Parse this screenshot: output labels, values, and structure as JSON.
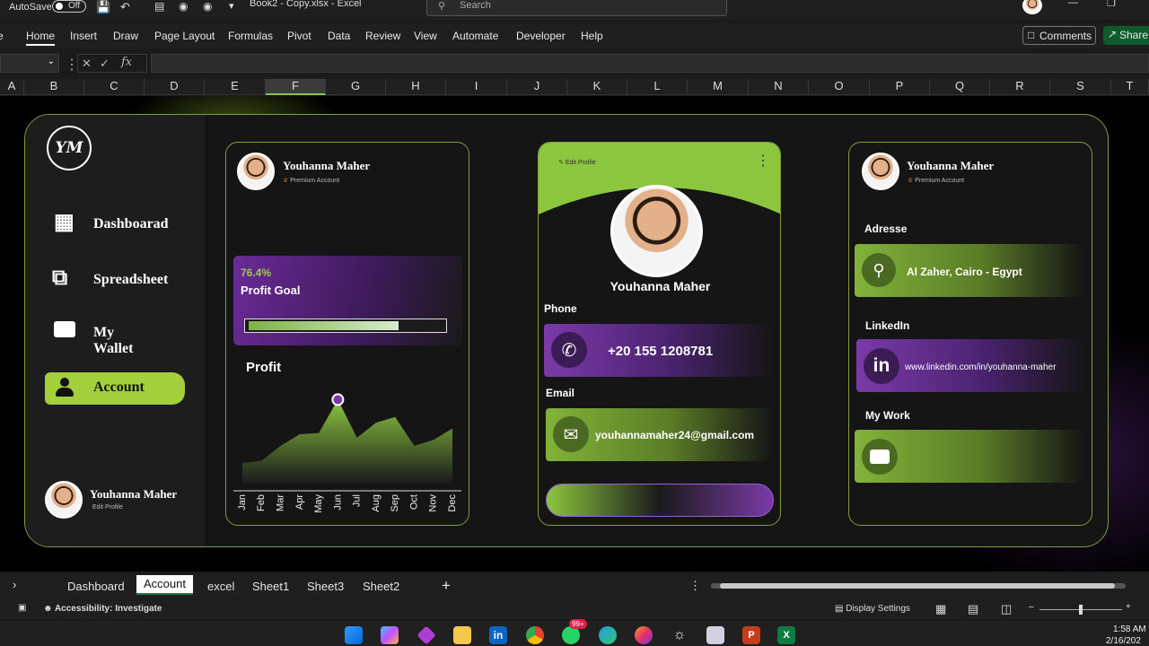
{
  "window": {
    "autosave_label": "AutoSave",
    "autosave_state": "Off",
    "title": "Book2 - Copy.xlsx  -  Excel",
    "search_placeholder": "Search"
  },
  "ribbon": {
    "tabs": [
      "Home",
      "Insert",
      "Draw",
      "Page Layout",
      "Formulas",
      "Pivot",
      "Data",
      "Review",
      "View",
      "Automate",
      "Developer",
      "Help"
    ],
    "comments": "Comments",
    "share": "Share"
  },
  "formula": {
    "fx": "fx"
  },
  "columns": [
    "A",
    "B",
    "C",
    "D",
    "E",
    "F",
    "G",
    "H",
    "I",
    "J",
    "K",
    "L",
    "M",
    "N",
    "O",
    "P",
    "Q",
    "R",
    "S",
    "T"
  ],
  "sidebar": {
    "logo": "YM",
    "items": [
      {
        "label": "Dashboarad",
        "icon": "grid-icon"
      },
      {
        "label": "Spreadsheet",
        "icon": "sheets-icon"
      },
      {
        "label": "My Wallet",
        "icon": "wallet-icon"
      },
      {
        "label": "Account",
        "icon": "user-icon"
      }
    ],
    "user_name": "Youhanna Maher",
    "user_sub": "Edit Profile"
  },
  "card1": {
    "name": "Youhanna Maher",
    "badge": "Premium Account",
    "profit_pct": "76.4%",
    "profit_goal_label": "Profit Goal",
    "progress": 0.764,
    "profit_title": "Profit"
  },
  "chart_data": {
    "type": "area",
    "title": "Profit",
    "categories": [
      "Jan",
      "Feb",
      "Mar",
      "Apr",
      "May",
      "Jun",
      "Jul",
      "Aug",
      "Sep",
      "Oct",
      "Nov",
      "Dec"
    ],
    "values": [
      10,
      12,
      25,
      35,
      36,
      65,
      32,
      45,
      50,
      25,
      30,
      40
    ],
    "highlight": "Jun",
    "color": "#7cb342"
  },
  "card2": {
    "edit": "Edit Profile",
    "name": "Youhanna Maher",
    "phone_label": "Phone",
    "phone": "+20 155 1208781",
    "email_label": "Email",
    "email": "youhannamaher24@gmail.com"
  },
  "card3": {
    "name": "Youhanna Maher",
    "badge": "Premium Account",
    "address_label": "Adresse",
    "address": "Al Zaher, Cairo - Egypt",
    "linkedin_label": "LinkedIn",
    "linkedin": "www.linkedin.com/in/youhanna-maher",
    "work_label": "My Work"
  },
  "sheets": {
    "tabs": [
      "Dashboard",
      "Account",
      "excel",
      "Sheet1",
      "Sheet3",
      "Sheet2"
    ],
    "active": "Account"
  },
  "status": {
    "accessibility": "Accessibility: Investigate",
    "display": "Display Settings"
  },
  "taskbar": {
    "time": "1:58 AM",
    "date": "2/16/202",
    "badge": "99+"
  }
}
